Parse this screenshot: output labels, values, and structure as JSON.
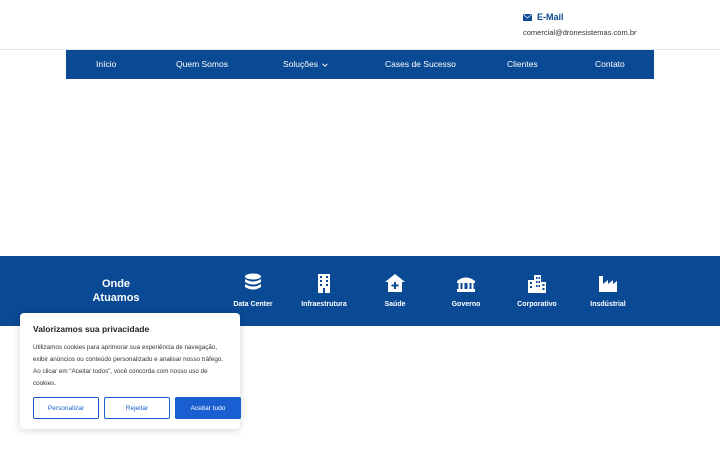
{
  "header": {
    "email_title": "E-Mail",
    "email_address": "comercial@dronesistemas.com.br"
  },
  "nav": {
    "items": [
      {
        "label": "Início"
      },
      {
        "label": "Quem Somos"
      },
      {
        "label": "Soluções"
      },
      {
        "label": "Cases de Sucesso"
      },
      {
        "label": "Clientes"
      },
      {
        "label": "Contato"
      }
    ]
  },
  "sectors": {
    "title": "Onde Atuamos",
    "items": [
      {
        "label": "Data Center",
        "icon": "database-icon"
      },
      {
        "label": "Infraestrutura",
        "icon": "building-icon"
      },
      {
        "label": "Saúde",
        "icon": "clinic-icon"
      },
      {
        "label": "Governo",
        "icon": "government-icon"
      },
      {
        "label": "Corporativo",
        "icon": "city-icon"
      },
      {
        "label": "Insdústrial",
        "icon": "factory-icon"
      }
    ]
  },
  "cookie": {
    "title": "Valorizamos sua privacidade",
    "text": "Utilizamos cookies para aprimorar sua experiência de navegação, exibir anúncios ou conteúdo personalizado e analisar nosso tráfego. Ao clicar em “Aceitar todos”, você concorda com nosso uso de cookies.",
    "customize_label": "Personalizar",
    "reject_label": "Rejeitar",
    "accept_label": "Aceitar tudo"
  },
  "colors": {
    "brand_blue": "#0a4a94",
    "button_blue": "#1a5fd1"
  }
}
